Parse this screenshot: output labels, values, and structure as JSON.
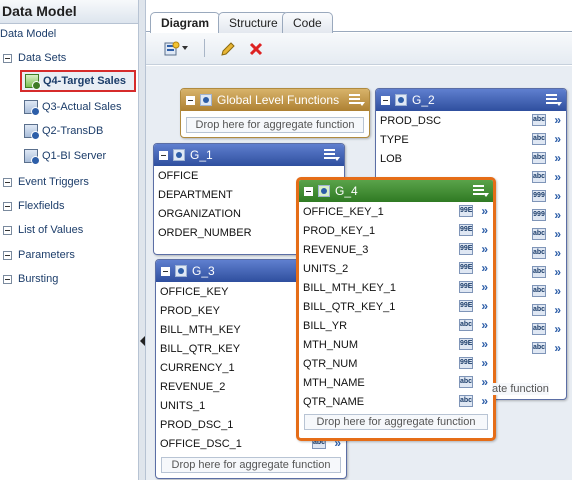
{
  "left": {
    "title": "Data Model",
    "root": "Data Model",
    "items": [
      {
        "label": "Data Sets"
      },
      {
        "label": "Event Triggers"
      },
      {
        "label": "Flexfields"
      },
      {
        "label": "List of Values"
      },
      {
        "label": "Parameters"
      },
      {
        "label": "Bursting"
      }
    ],
    "datasets": [
      "Q4-Target Sales",
      "Q3-Actual Sales",
      "Q2-TransDB",
      "Q1-BI Server"
    ]
  },
  "tabs": [
    "Diagram",
    "Structure",
    "Code"
  ],
  "global": {
    "title": "Global Level Functions",
    "drop": "Drop here for aggregate function"
  },
  "g1": {
    "title": "G_1",
    "fields": [
      "OFFICE",
      "DEPARTMENT",
      "ORGANIZATION",
      "ORDER_NUMBER"
    ]
  },
  "g2": {
    "title": "G_2",
    "fields": [
      "PROD_DSC",
      "TYPE",
      "LOB",
      "",
      "",
      "",
      "",
      "",
      "",
      "",
      "",
      "",
      ""
    ],
    "types": [
      "abc",
      "abc",
      "abc",
      "abc",
      "999",
      "999",
      "abc",
      "abc",
      "abc",
      "abc",
      "abc",
      "abc",
      "abc"
    ],
    "drop": "Drop here for aggregate function"
  },
  "g3": {
    "title": "G_3",
    "fields": [
      "OFFICE_KEY",
      "PROD_KEY",
      "BILL_MTH_KEY",
      "BILL_QTR_KEY",
      "CURRENCY_1",
      "REVENUE_2",
      "UNITS_1",
      "PROD_DSC_1",
      "OFFICE_DSC_1"
    ],
    "drop": "Drop here for aggregate function"
  },
  "g4": {
    "title": "G_4",
    "fields": [
      {
        "name": "OFFICE_KEY_1",
        "type": "99E"
      },
      {
        "name": "PROD_KEY_1",
        "type": "99E"
      },
      {
        "name": "REVENUE_3",
        "type": "99E"
      },
      {
        "name": "UNITS_2",
        "type": "99E"
      },
      {
        "name": "BILL_MTH_KEY_1",
        "type": "99E"
      },
      {
        "name": "BILL_QTR_KEY_1",
        "type": "99E"
      },
      {
        "name": "BILL_YR",
        "type": "abc"
      },
      {
        "name": "MTH_NUM",
        "type": "99E"
      },
      {
        "name": "QTR_NUM",
        "type": "99E"
      },
      {
        "name": "MTH_NAME",
        "type": "abc"
      },
      {
        "name": "QTR_NAME",
        "type": "abc"
      }
    ],
    "drop": "Drop here for aggregate function"
  },
  "colors": {
    "header_blue": "#3b5bb0",
    "header_gold": "#c0954a",
    "header_green": "#3f8a32",
    "highlight": "#e56d18"
  }
}
